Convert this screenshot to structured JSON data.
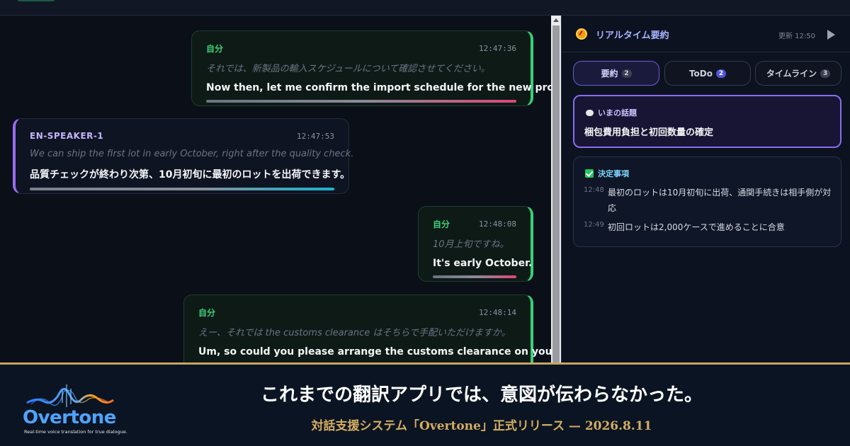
{
  "chat": {
    "messages": [
      {
        "speaker": "自分",
        "time": "12:47:36",
        "original": "それでは、新製品の輸入スケジュールについて確認させてください。",
        "translation": "Now then, let me confirm the import schedule for the new product.",
        "side": "me"
      },
      {
        "speaker": "EN-SPEAKER-1",
        "time": "12:47:53",
        "original": "We can ship the first lot in early October, right after the quality check.",
        "translation": "品質チェックが終わり次第、10月初旬に最初のロットを出荷できます。",
        "side": "other"
      },
      {
        "speaker": "自分",
        "time": "12:48:08",
        "original": "10月上旬ですね。",
        "translation": "It's early October.",
        "side": "me"
      },
      {
        "speaker": "自分",
        "time": "12:48:14",
        "original": "えー、それでは the customs clearance はそちらで手配いただけますか。",
        "translation": "Um, so could you please arrange the customs clearance on your end?",
        "side": "me"
      }
    ]
  },
  "panel": {
    "title": "リアルタイム要約",
    "updated": "更新 12:50",
    "tabs": [
      {
        "label": "要約",
        "count": "2"
      },
      {
        "label": "ToDo",
        "count": "2"
      },
      {
        "label": "タイムライン",
        "count": "3"
      }
    ],
    "topic": {
      "label": "いまの話題",
      "text": "梱包費用負担と初回数量の確定"
    },
    "decisions": {
      "label": "決定事項",
      "items": [
        {
          "time": "12:48",
          "text": "最初のロットは10月初旬に出荷、通関手続きは相手側が対応"
        },
        {
          "time": "12:49",
          "text": "初回ロットは2,000ケースで進めることに合意"
        }
      ]
    }
  },
  "footer": {
    "logo_name": "Overtone",
    "logo_tagline": "Real-time voice translation for true dialogue.",
    "headline": "これまでの翻訳アプリでは、意図が伝わらなかった。",
    "subline": "対話支援システム「Overtone」正式リリース — 2026.8.11"
  }
}
